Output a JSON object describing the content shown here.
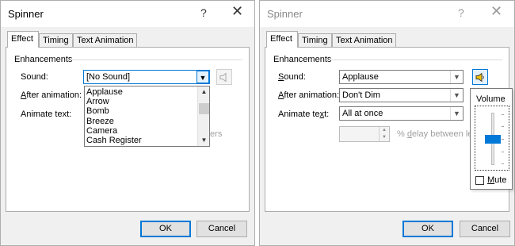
{
  "left_dialog": {
    "title": "Spinner",
    "help_glyph": "?",
    "close_glyph": "✕",
    "tabs": [
      {
        "label": "Effect",
        "active": true
      },
      {
        "label": "Timing",
        "active": false
      },
      {
        "label": "Text Animation",
        "active": false
      }
    ],
    "group_label": "Enhancements",
    "sound_label": "Sound:",
    "sound_value": "[No Sound]",
    "after_animation_label_underlined": "A",
    "after_animation_label_rest": "fter animation:",
    "animate_text_label": "Animate text:",
    "sound_options": [
      "Applause",
      "Arrow",
      "Bomb",
      "Breeze",
      "Camera",
      "Cash Register"
    ],
    "partial_text": "ters",
    "ok_label": "OK",
    "cancel_label": "Cancel"
  },
  "right_dialog": {
    "title": "Spinner",
    "help_glyph": "?",
    "close_glyph": "✕",
    "tabs": [
      {
        "label": "Effect",
        "active": true
      },
      {
        "label": "Timing",
        "active": false
      },
      {
        "label": "Text Animation",
        "active": false
      }
    ],
    "group_label": "Enhancements",
    "sound_label_underlined": "S",
    "sound_label_rest": "ound:",
    "sound_value": "Applause",
    "after_animation_label_underlined": "A",
    "after_animation_label_rest": "fter animation:",
    "after_animation_value": "Don't Dim",
    "animate_text_label_a": "Animate te",
    "animate_text_label_underlined": "x",
    "animate_text_label_b": "t:",
    "animate_text_value": "All at once",
    "delay_label_a": "% ",
    "delay_label_underlined": "d",
    "delay_label_b": "elay between lette",
    "volume_popup": {
      "title": "Volume",
      "level_percent": 50,
      "mute_label_underlined": "M",
      "mute_label_rest": "ute",
      "mute_checked": false
    },
    "ok_label": "OK",
    "cancel_label": "Cancel"
  },
  "colors": {
    "accent": "#0078d7",
    "dialog_bg": "#f0f0f0",
    "border": "#adadad"
  },
  "icons": [
    "speaker-icon",
    "chevron-down-icon",
    "close-icon",
    "help-icon",
    "spin-up-icon",
    "spin-down-icon"
  ]
}
